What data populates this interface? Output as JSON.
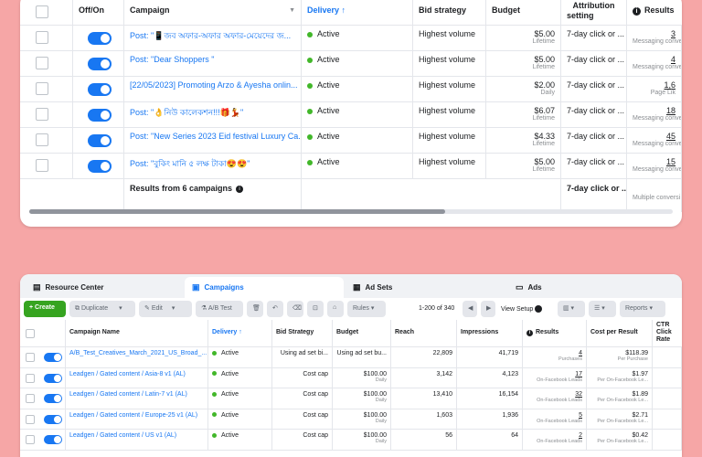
{
  "top": {
    "headers": {
      "onoff": "Off/On",
      "campaign": "Campaign",
      "delivery": "Delivery",
      "delivery_sort": "↑",
      "bid": "Bid strategy",
      "budget": "Budget",
      "attribution_1": "Attribution",
      "attribution_2": "setting",
      "results": "Results"
    },
    "rows": [
      {
        "campaign": "Post: \"📱জব অফার-অফার অফার-মেয়েদের জ...",
        "delivery": "Active",
        "bid": "Highest volume",
        "budget": "$5.00",
        "budget_type": "Lifetime",
        "attribution": "7-day click or ...",
        "results": "3",
        "results_sub": "Messaging conver..."
      },
      {
        "campaign": "Post: \"Dear Shoppers \"",
        "delivery": "Active",
        "bid": "Highest volume",
        "budget": "$5.00",
        "budget_type": "Lifetime",
        "attribution": "7-day click or ...",
        "results": "4",
        "results_sub": "Messaging conver..."
      },
      {
        "campaign": "[22/05/2023] Promoting Arzo & Ayesha onlin...",
        "delivery": "Active",
        "bid": "Highest volume",
        "budget": "$2.00",
        "budget_type": "Daily",
        "attribution": "7-day click or ...",
        "results": "1,6",
        "results_sub": "Page Lik"
      },
      {
        "campaign": "Post: \"👌নিউ কালেকশন!!!🎁💃\"",
        "delivery": "Active",
        "bid": "Highest volume",
        "budget": "$6.07",
        "budget_type": "Lifetime",
        "attribution": "7-day click or ...",
        "results": "18",
        "results_sub": "Messaging conver..."
      },
      {
        "campaign": "Post: \"New Series 2023 Eid festival Luxury Ca...",
        "delivery": "Active",
        "bid": "Highest volume",
        "budget": "$4.33",
        "budget_type": "Lifetime",
        "attribution": "7-day click or ...",
        "results": "45",
        "results_sub": "Messaging conver..."
      },
      {
        "campaign": "Post: \"বুকিং মানি ৫ লক্ষ টাকা😍😍\"",
        "delivery": "Active",
        "bid": "Highest volume",
        "budget": "$5.00",
        "budget_type": "Lifetime",
        "attribution": "7-day click or ...",
        "results": "15",
        "results_sub": "Messaging conver..."
      }
    ],
    "footer": {
      "summary": "Results from 6 campaigns",
      "attribution": "7-day click or ...",
      "results_sub": "Multiple conversi"
    }
  },
  "bottom": {
    "tabs": {
      "resource": "Resource Center",
      "campaigns": "Campaigns",
      "adsets": "Ad Sets",
      "ads": "Ads"
    },
    "toolbar": {
      "create": "Create",
      "duplicate": "Duplicate",
      "edit": "Edit",
      "abtest": "A/B Test",
      "rules": "Rules",
      "pagination": "1-200 of 340",
      "viewsetup": "View Setup",
      "reports": "Reports"
    },
    "headers": {
      "name": "Campaign Name",
      "delivery": "Delivery",
      "delivery_sort": "↑",
      "bid": "Bid Strategy",
      "budget": "Budget",
      "reach": "Reach",
      "impressions": "Impressions",
      "results": "Results",
      "cpr": "Cost per Result",
      "ctr_1": "CTR",
      "ctr_2": "Click",
      "ctr_3": "Rate"
    },
    "rows": [
      {
        "name": "A/B_Test_Creatives_March_2021_US_Broad_...",
        "delivery": "Active",
        "bid": "Using ad set bi...",
        "budget": "Using ad set bu...",
        "budget_type": "",
        "reach": "22,809",
        "impressions": "41,719",
        "results": "4",
        "results_sub": "Purchases",
        "cpr": "$118.39",
        "cpr_sub": "Per Purchase"
      },
      {
        "name": "Leadgen / Gated content / Asia-8 v1 (AL)",
        "delivery": "Active",
        "bid": "Cost cap",
        "budget": "$100.00",
        "budget_type": "Daily",
        "reach": "3,142",
        "impressions": "4,123",
        "results": "17",
        "results_sub": "On-Facebook Leads",
        "cpr": "$1.97",
        "cpr_sub": "Per On-Facebook Le..."
      },
      {
        "name": "Leadgen / Gated content / Latin-7 v1 (AL)",
        "delivery": "Active",
        "bid": "Cost cap",
        "budget": "$100.00",
        "budget_type": "Daily",
        "reach": "13,410",
        "impressions": "16,154",
        "results": "32",
        "results_sub": "On-Facebook Leads",
        "cpr": "$1.89",
        "cpr_sub": "Per On-Facebook Le..."
      },
      {
        "name": "Leadgen / Gated content / Europe-25 v1 (AL)",
        "delivery": "Active",
        "bid": "Cost cap",
        "budget": "$100.00",
        "budget_type": "Daily",
        "reach": "1,603",
        "impressions": "1,936",
        "results": "5",
        "results_sub": "On-Facebook Leads",
        "cpr": "$2.71",
        "cpr_sub": "Per On-Facebook Le..."
      },
      {
        "name": "Leadgen / Gated content / US v1 (AL)",
        "delivery": "Active",
        "bid": "Cost cap",
        "budget": "$100.00",
        "budget_type": "Daily",
        "reach": "56",
        "impressions": "64",
        "results": "2",
        "results_sub": "On-Facebook Leads",
        "cpr": "$0.42",
        "cpr_sub": "Per On-Facebook Le..."
      }
    ]
  },
  "colors": {
    "background": "#f6a6a6",
    "accent": "#1877f2",
    "active_dot": "#42b72a",
    "create_button": "#36a420"
  }
}
